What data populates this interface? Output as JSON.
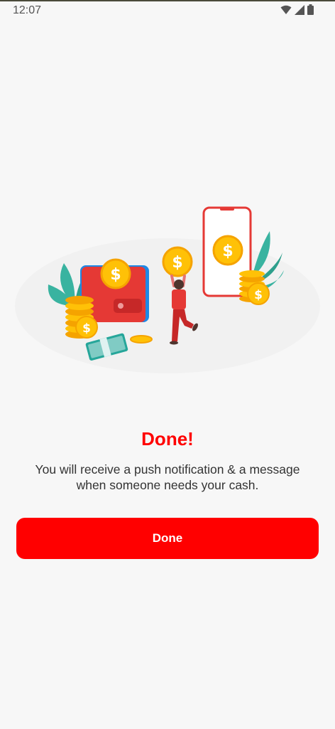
{
  "status_bar": {
    "time": "12:07",
    "icons": [
      "wifi-icon",
      "cellular-signal-icon",
      "battery-icon"
    ]
  },
  "illustration": {
    "icon_name": "wallet-coins-phone-illustration",
    "coin_symbol": "$"
  },
  "content": {
    "title": "Done!",
    "message": "You will receive a push notification & a message when someone needs your cash."
  },
  "actions": {
    "done_label": "Done"
  },
  "colors": {
    "accent": "#ff0000",
    "background": "#f7f7f7",
    "text": "#333333"
  }
}
